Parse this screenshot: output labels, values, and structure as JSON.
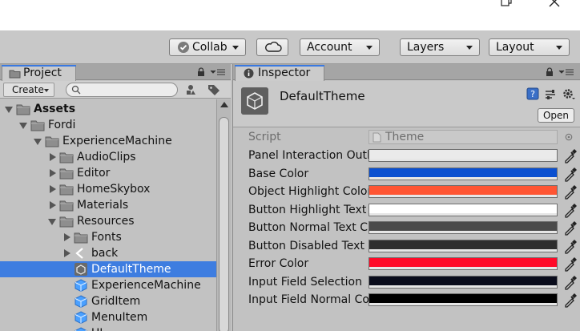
{
  "toolbar": {
    "collab_label": "Collab",
    "account_label": "Account",
    "layers_label": "Layers",
    "layout_label": "Layout"
  },
  "project": {
    "tab_label": "Project",
    "create_label": "Create",
    "tree": [
      {
        "label": "Assets",
        "fold": "open",
        "icon": "folder-icon",
        "bold": true
      },
      {
        "label": "Fordi",
        "fold": "open",
        "icon": "folder-icon"
      },
      {
        "label": "ExperienceMachine",
        "fold": "open",
        "icon": "folder-icon"
      },
      {
        "label": "AudioClips",
        "fold": "closed",
        "icon": "folder-icon"
      },
      {
        "label": "Editor",
        "fold": "closed",
        "icon": "folder-icon"
      },
      {
        "label": "HomeSkybox",
        "fold": "closed",
        "icon": "folder-icon"
      },
      {
        "label": "Materials",
        "fold": "closed",
        "icon": "folder-icon"
      },
      {
        "label": "Resources",
        "fold": "open",
        "icon": "folder-icon"
      },
      {
        "label": "Fonts",
        "fold": "closed",
        "icon": "folder-icon"
      },
      {
        "label": "back",
        "fold": "closed",
        "icon": "back-arrow-icon"
      },
      {
        "label": "DefaultTheme",
        "fold": "none",
        "icon": "theme-asset-icon",
        "selected": true
      },
      {
        "label": "ExperienceMachine",
        "fold": "none",
        "icon": "prefab-icon"
      },
      {
        "label": "GridItem",
        "fold": "none",
        "icon": "prefab-icon"
      },
      {
        "label": "MenuItem",
        "fold": "none",
        "icon": "prefab-icon"
      },
      {
        "label": "UI",
        "fold": "none",
        "icon": "prefab-icon"
      }
    ]
  },
  "inspector": {
    "tab_label": "Inspector",
    "title": "DefaultTheme",
    "open_label": "Open",
    "script_label": "Script",
    "script_value": "Theme",
    "properties": [
      {
        "name": "Panel Interaction Outl",
        "color": "#eaeaea"
      },
      {
        "name": "Base Color",
        "color": "#0a4fd0"
      },
      {
        "name": "Object Highlight Color",
        "color": "#ff5533"
      },
      {
        "name": "Button Highlight Text",
        "color": "#ffffff"
      },
      {
        "name": "Button Normal Text C",
        "color": "#4a4a4a"
      },
      {
        "name": "Button Disabled Text",
        "color": "#2e2e2e"
      },
      {
        "name": "Error Color",
        "color": "#ff0a28"
      },
      {
        "name": "Input Field Selection",
        "color": "#0a0c1c"
      },
      {
        "name": "Input Field Normal Co",
        "color": "#000000"
      }
    ]
  }
}
